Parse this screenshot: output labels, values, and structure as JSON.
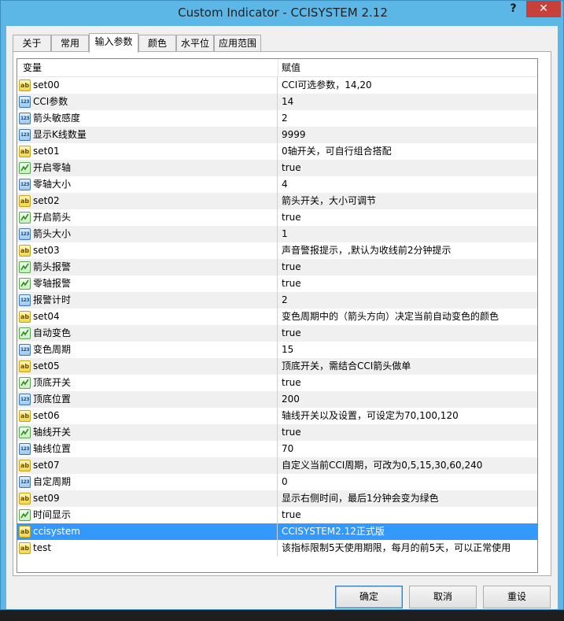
{
  "window": {
    "title": "Custom Indicator - CCISYSTEM 2.12",
    "help_icon": "?",
    "close_icon": "✕"
  },
  "tabs": [
    {
      "label": "关于"
    },
    {
      "label": "常用"
    },
    {
      "label": "输入参数"
    },
    {
      "label": "颜色"
    },
    {
      "label": "水平位"
    },
    {
      "label": "应用范围"
    }
  ],
  "active_tab": "输入参数",
  "grid": {
    "headers": {
      "variable": "变量",
      "value": "赋值"
    },
    "rows": [
      {
        "icon": "ab",
        "name": "set00",
        "value": "CCI可选参数，14,20"
      },
      {
        "icon": "123",
        "name": "CCI参数",
        "value": "14"
      },
      {
        "icon": "123",
        "name": "箭头敏感度",
        "value": "2"
      },
      {
        "icon": "123",
        "name": "显示K线数量",
        "value": "9999"
      },
      {
        "icon": "ab",
        "name": "set01",
        "value": "0轴开关，可自行组合搭配"
      },
      {
        "icon": "bool",
        "name": "开启零轴",
        "value": "true"
      },
      {
        "icon": "123",
        "name": "零轴大小",
        "value": "4"
      },
      {
        "icon": "ab",
        "name": "set02",
        "value": "箭头开关，大小可调节"
      },
      {
        "icon": "bool",
        "name": "开启箭头",
        "value": "true"
      },
      {
        "icon": "123",
        "name": "箭头大小",
        "value": "1"
      },
      {
        "icon": "ab",
        "name": "set03",
        "value": "声音警报提示，,默认为收线前2分钟提示"
      },
      {
        "icon": "bool",
        "name": "箭头报警",
        "value": "true"
      },
      {
        "icon": "bool",
        "name": "零轴报警",
        "value": "true"
      },
      {
        "icon": "123",
        "name": "报警计时",
        "value": "2"
      },
      {
        "icon": "ab",
        "name": "set04",
        "value": "变色周期中的（箭头方向）决定当前自动变色的颜色"
      },
      {
        "icon": "bool",
        "name": "自动变色",
        "value": "true"
      },
      {
        "icon": "123",
        "name": "变色周期",
        "value": "15"
      },
      {
        "icon": "ab",
        "name": "set05",
        "value": "顶底开关，需结合CCI箭头做单"
      },
      {
        "icon": "bool",
        "name": "顶底开关",
        "value": "true"
      },
      {
        "icon": "123",
        "name": "顶底位置",
        "value": "200"
      },
      {
        "icon": "ab",
        "name": "set06",
        "value": "轴线开关以及设置，可设定为70,100,120"
      },
      {
        "icon": "bool",
        "name": "轴线开关",
        "value": "true"
      },
      {
        "icon": "123",
        "name": "轴线位置",
        "value": "70"
      },
      {
        "icon": "ab",
        "name": "set07",
        "value": "自定义当前CCI周期，可改为0,5,15,30,60,240"
      },
      {
        "icon": "123",
        "name": "自定周期",
        "value": "0"
      },
      {
        "icon": "ab",
        "name": "set09",
        "value": "显示右侧时间，最后1分钟会变为绿色"
      },
      {
        "icon": "bool",
        "name": "时间显示",
        "value": "true"
      },
      {
        "icon": "ab",
        "name": "ccisystem",
        "value": "CCISYSTEM2.12正式版",
        "selected": true
      },
      {
        "icon": "ab",
        "name": "test",
        "value": "该指标限制5天使用期限，每月的前5天，可以正常使用"
      }
    ]
  },
  "buttons": {
    "ok": "确定",
    "cancel": "取消",
    "reset": "重设"
  },
  "icon_text": {
    "ab": "ab",
    "n123": "123"
  },
  "colors": {
    "titlebar": "#5cb6e6",
    "selection": "#3399ff",
    "close": "#c7413a"
  }
}
